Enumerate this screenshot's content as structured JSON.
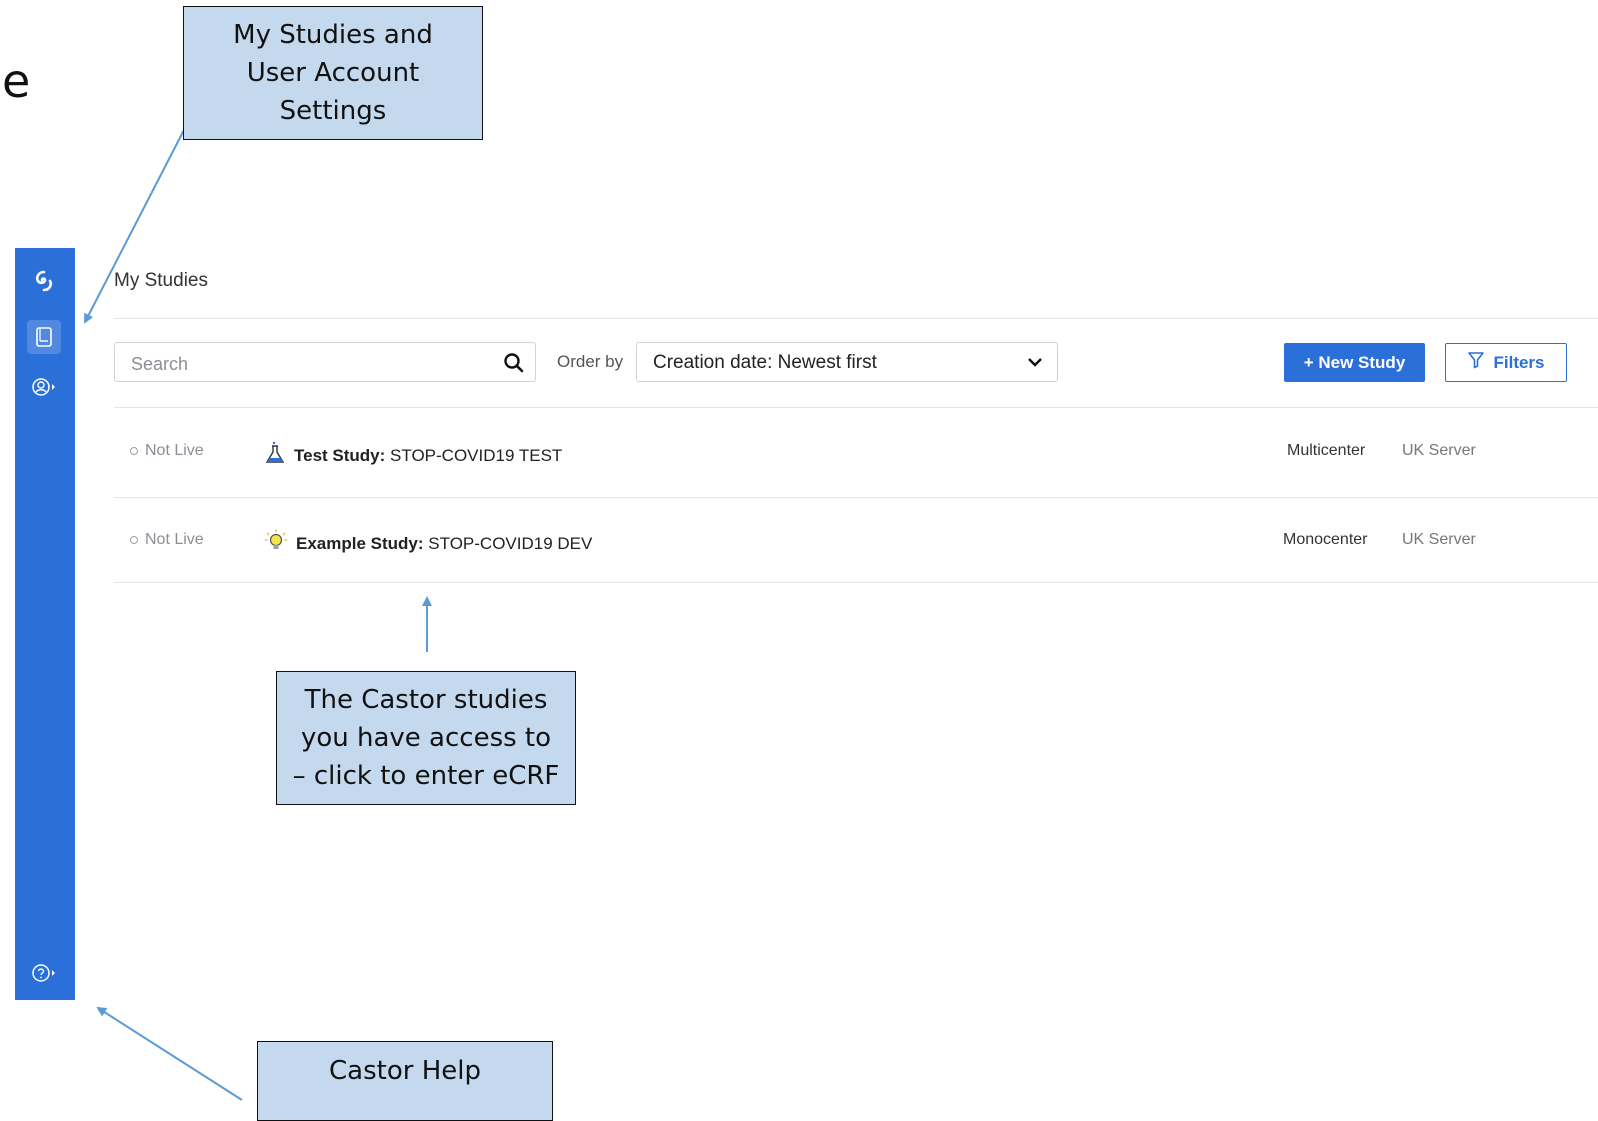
{
  "slide": {
    "fragment": "e"
  },
  "callouts": {
    "top": [
      "My Studies and",
      "User Account",
      "Settings"
    ],
    "middle": [
      "The Castor studies",
      "you have access to",
      "– click to enter eCRF"
    ],
    "help": [
      "Castor Help"
    ]
  },
  "sidebar": {
    "icons": [
      "castor-logo-icon",
      "studies-book-icon",
      "user-account-icon",
      "help-icon"
    ]
  },
  "page": {
    "title": "My Studies"
  },
  "toolbar": {
    "search_placeholder": "Search",
    "order_label": "Order by",
    "order_value": "Creation date: Newest first",
    "new_study_label": "+ New Study",
    "filters_label": "Filters"
  },
  "studies": [
    {
      "status": "Not Live",
      "type": "Test Study:",
      "name": "STOP-COVID19 TEST",
      "center": "Multicenter",
      "server": "UK Server",
      "icon": "flask-icon"
    },
    {
      "status": "Not Live",
      "type": "Example Study:",
      "name": "STOP-COVID19 DEV",
      "center": "Monocenter",
      "server": "UK Server",
      "icon": "lightbulb-icon"
    }
  ],
  "colors": {
    "accent": "#2b6fd9",
    "callout_bg": "#c5d9ee",
    "arrow": "#5b9bd5"
  }
}
